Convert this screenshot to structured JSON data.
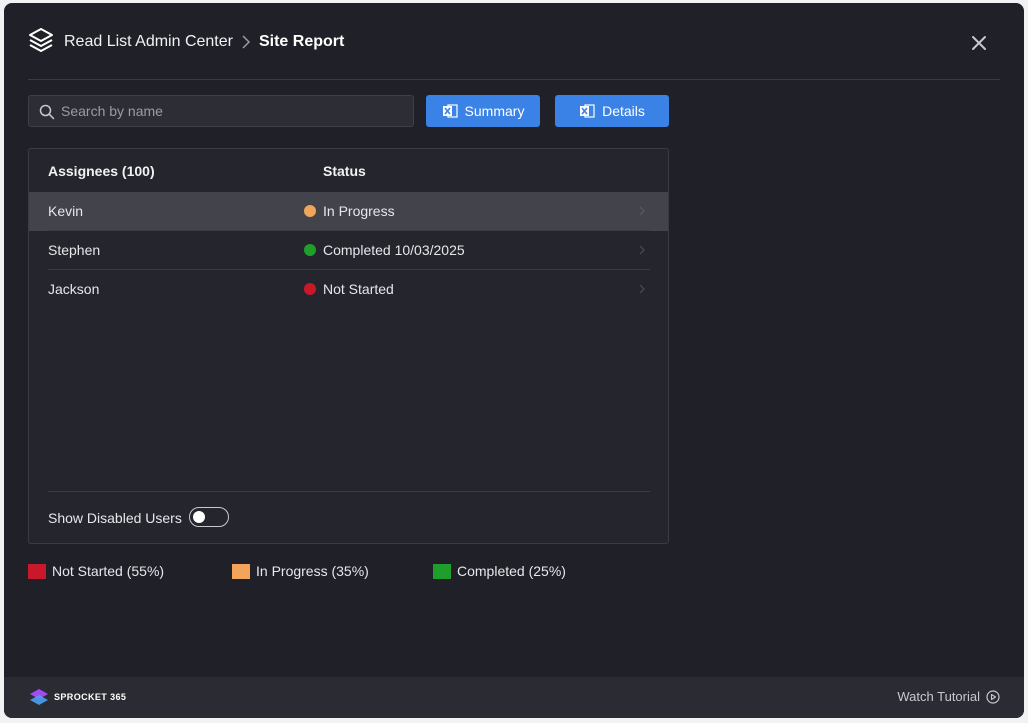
{
  "header": {
    "app_title": "Read List Admin Center",
    "separator": ">",
    "current_page": "Site Report"
  },
  "toolbar": {
    "search_placeholder": "Search by name",
    "search_value": "",
    "summary_label": "Summary",
    "details_label": "Details"
  },
  "table": {
    "columns": [
      "Assignees (100)",
      "Status"
    ],
    "rows": [
      {
        "name": "Kevin",
        "status": "In Progress",
        "status_color": "#f2a55a",
        "selected": true
      },
      {
        "name": "Stephen",
        "status": "Completed 10/03/2025",
        "status_color": "#1f9e2c",
        "selected": false
      },
      {
        "name": "Jackson",
        "status": "Not Started",
        "status_color": "#c8182a",
        "selected": false
      }
    ],
    "show_disabled_label": "Show Disabled Users",
    "show_disabled_on": false
  },
  "legend": [
    {
      "label": "Not Started (55%)",
      "color": "#c8182a"
    },
    {
      "label": "In Progress (35%)",
      "color": "#f2a55a"
    },
    {
      "label": "Completed (25%)",
      "color": "#1f9e2c"
    }
  ],
  "footer": {
    "brand": "SPROCKET 365",
    "tutorial_label": "Watch Tutorial"
  },
  "colors": {
    "accent": "#3b82e6",
    "background": "#202128"
  },
  "icons": [
    "layers-logo-icon",
    "chevron-right-icon",
    "close-icon",
    "search-icon",
    "excel-icon",
    "play-circle-icon",
    "sprocket-logo-icon"
  ]
}
